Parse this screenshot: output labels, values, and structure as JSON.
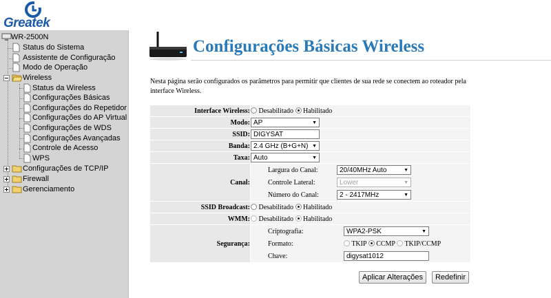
{
  "brand": {
    "name": "Greatek"
  },
  "sidebar": {
    "root": "WR-2500N",
    "items": [
      {
        "label": "Status do Sistema"
      },
      {
        "label": "Assistente de Configuração"
      },
      {
        "label": "Modo de Operação"
      },
      {
        "label": "Wireless"
      },
      {
        "label": "Status da Wireless"
      },
      {
        "label": "Configurações Básicas"
      },
      {
        "label": "Configurações do Repetidor"
      },
      {
        "label": "Configurações do AP Virtual"
      },
      {
        "label": "Configurações de WDS"
      },
      {
        "label": "Configurações Avançadas"
      },
      {
        "label": "Controle de Acesso"
      },
      {
        "label": "WPS"
      },
      {
        "label": "Configurações de TCP/IP"
      },
      {
        "label": "Firewall"
      },
      {
        "label": "Gerenciamento"
      }
    ]
  },
  "page": {
    "title": "Configurações Básicas Wireless",
    "description": "Nesta página serão configurados os parâmetros para permitir que clientes de sua rede se conectem ao roteador pela interface Wireless."
  },
  "form": {
    "interface_label": "Interface Wireless:",
    "disabled": "Desabilitado",
    "enabled": "Habilitado",
    "mode_label": "Modo:",
    "mode_value": "AP",
    "ssid_label": "SSID:",
    "ssid_value": "DIGYSAT",
    "band_label": "Banda:",
    "band_value": "2.4 GHz (B+G+N)",
    "rate_label": "Taxa:",
    "rate_value": "Auto",
    "channel_label": "Canal:",
    "channel_width_label": "Largura do Canal:",
    "channel_width_value": "20/40MHz Auto",
    "side_control_label": "Controle Lateral:",
    "side_control_value": "Lower",
    "channel_number_label": "Número do Canal:",
    "channel_number_value": "2 - 2417MHz",
    "ssid_broadcast_label": "SSID Broadcast:",
    "wmm_label": "WMM:",
    "security_label": "Segurança:",
    "crypto_label": "Criptografia:",
    "crypto_value": "WPA2-PSK",
    "format_label": "Formato:",
    "tkip": "TKIP",
    "ccmp": "CCMP",
    "tkip_ccmp": "TKIP/CCMP",
    "key_label": "Chave:",
    "key_value": "digysat1012"
  },
  "buttons": {
    "apply": "Aplicar Alterações",
    "reset": "Redefinir"
  }
}
